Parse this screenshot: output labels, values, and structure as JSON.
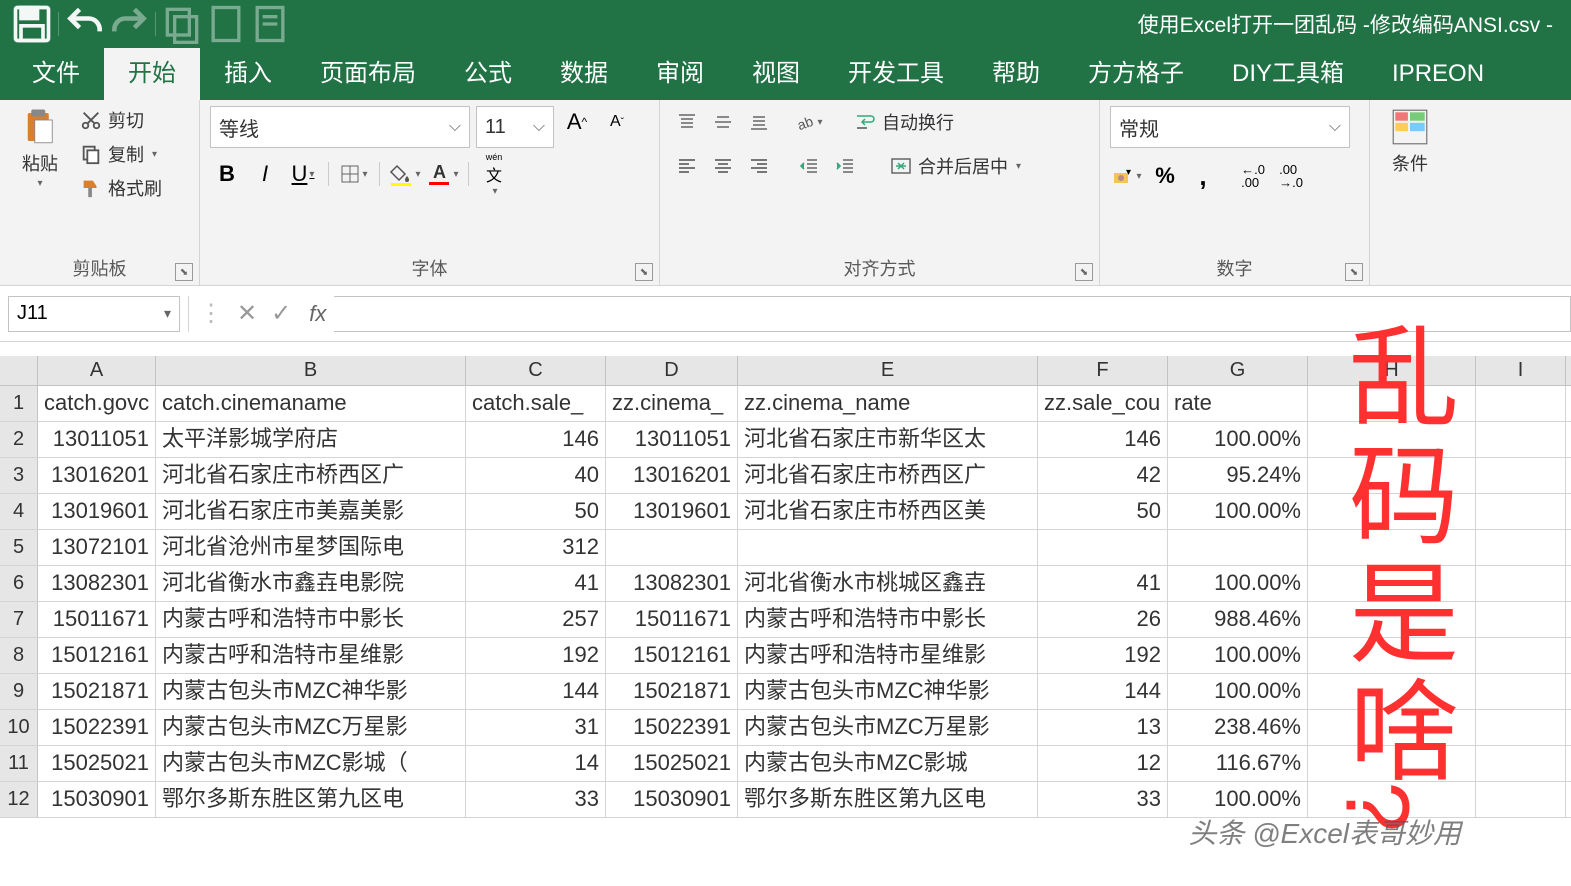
{
  "title": "使用Excel打开一团乱码 -修改编码ANSI.csv -",
  "tabs": [
    "文件",
    "开始",
    "插入",
    "页面布局",
    "公式",
    "数据",
    "审阅",
    "视图",
    "开发工具",
    "帮助",
    "方方格子",
    "DIY工具箱",
    "IPREON"
  ],
  "active_tab": 1,
  "clipboard": {
    "group": "剪贴板",
    "paste": "粘贴",
    "cut": "剪切",
    "copy": "复制",
    "painter": "格式刷"
  },
  "font": {
    "group": "字体",
    "name": "等线",
    "size": "11"
  },
  "align": {
    "group": "对齐方式",
    "wrap": "自动换行",
    "merge": "合并后居中"
  },
  "number": {
    "group": "数字",
    "format": "常规"
  },
  "cond": {
    "label": "条件"
  },
  "namebox": "J11",
  "columns": [
    "A",
    "B",
    "C",
    "D",
    "E",
    "F",
    "G",
    "H",
    "I"
  ],
  "headers": {
    "A": "catch.govc",
    "B": "catch.cinemaname",
    "C": "catch.sale_",
    "D": "zz.cinema_",
    "E": "zz.cinema_name",
    "F": "zz.sale_cou",
    "G": "rate"
  },
  "rows": [
    {
      "n": 2,
      "A": "13011051",
      "B": "太平洋影城学府店",
      "C": "146",
      "D": "13011051",
      "E": "河北省石家庄市新华区太",
      "F": "146",
      "G": "100.00%"
    },
    {
      "n": 3,
      "A": "13016201",
      "B": "河北省石家庄市桥西区广",
      "C": "40",
      "D": "13016201",
      "E": "河北省石家庄市桥西区广",
      "F": "42",
      "G": "95.24%"
    },
    {
      "n": 4,
      "A": "13019601",
      "B": "河北省石家庄市美嘉美影",
      "C": "50",
      "D": "13019601",
      "E": "河北省石家庄市桥西区美",
      "F": "50",
      "G": "100.00%"
    },
    {
      "n": 5,
      "A": "13072101",
      "B": "河北省沧州市星梦国际电",
      "C": "312",
      "D": "",
      "E": "",
      "F": "",
      "G": ""
    },
    {
      "n": 6,
      "A": "13082301",
      "B": "河北省衡水市鑫壵电影院",
      "C": "41",
      "D": "13082301",
      "E": "河北省衡水市桃城区鑫壵",
      "F": "41",
      "G": "100.00%"
    },
    {
      "n": 7,
      "A": "15011671",
      "B": "内蒙古呼和浩特市中影长",
      "C": "257",
      "D": "15011671",
      "E": "内蒙古呼和浩特市中影长",
      "F": "26",
      "G": "988.46%"
    },
    {
      "n": 8,
      "A": "15012161",
      "B": "内蒙古呼和浩特市星维影",
      "C": "192",
      "D": "15012161",
      "E": "内蒙古呼和浩特市星维影",
      "F": "192",
      "G": "100.00%"
    },
    {
      "n": 9,
      "A": "15021871",
      "B": "内蒙古包头市MZC神华影",
      "C": "144",
      "D": "15021871",
      "E": "内蒙古包头市MZC神华影",
      "F": "144",
      "G": "100.00%"
    },
    {
      "n": 10,
      "A": "15022391",
      "B": "内蒙古包头市MZC万星影",
      "C": "31",
      "D": "15022391",
      "E": "内蒙古包头市MZC万星影",
      "F": "13",
      "G": "238.46%"
    },
    {
      "n": 11,
      "A": "15025021",
      "B": "内蒙古包头市MZC影城（",
      "C": "14",
      "D": "15025021",
      "E": "内蒙古包头市MZC影城",
      "F": "12",
      "G": "116.67%"
    },
    {
      "n": 12,
      "A": "15030901",
      "B": "鄂尔多斯东胜区第九区电",
      "C": "33",
      "D": "15030901",
      "E": "鄂尔多斯东胜区第九区电",
      "F": "33",
      "G": "100.00%"
    }
  ],
  "overlay_text": "乱码是啥",
  "watermark": "头条 @Excel表哥妙用"
}
